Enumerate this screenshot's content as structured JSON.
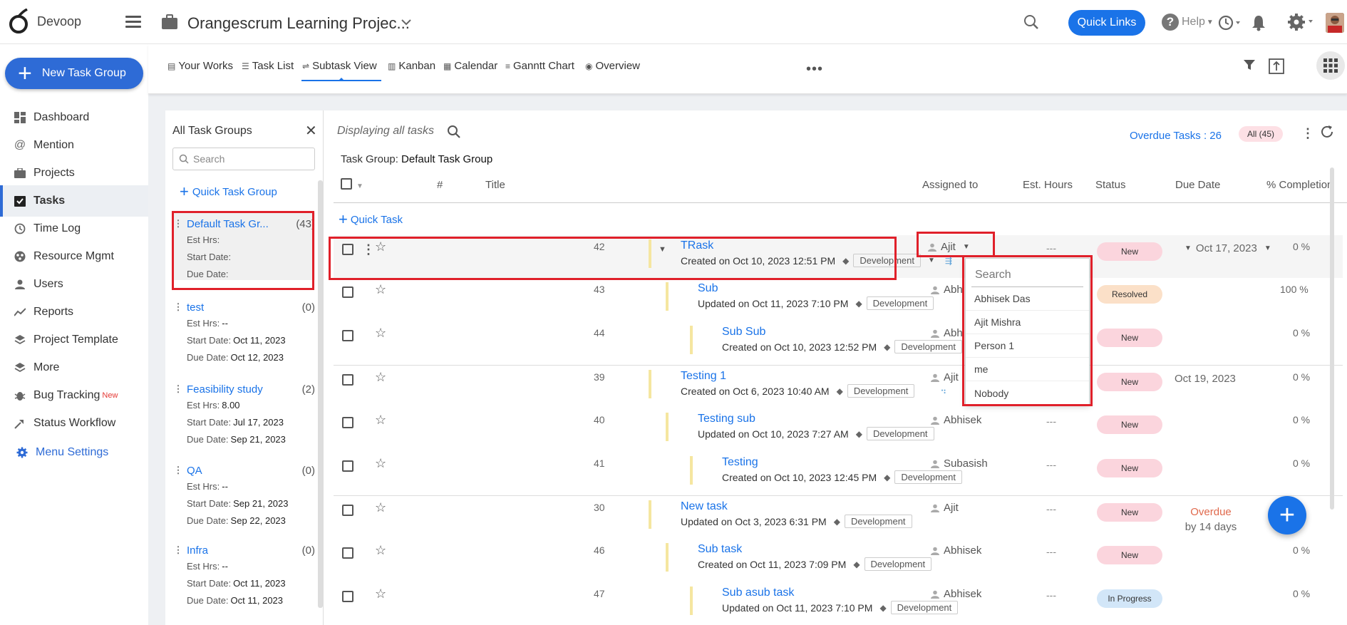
{
  "app": {
    "brand": "Devoop",
    "project_title": "Orangescrum Learning Projec...",
    "quick_links": "Quick Links",
    "help": "Help"
  },
  "sidebar": {
    "new_button": "New Task Group",
    "items": [
      {
        "label": "Dashboard",
        "icon": "dashboard-icon"
      },
      {
        "label": "Mention",
        "icon": "at-icon"
      },
      {
        "label": "Projects",
        "icon": "briefcase-icon"
      },
      {
        "label": "Tasks",
        "icon": "tasks-icon"
      },
      {
        "label": "Time Log",
        "icon": "clock-icon"
      },
      {
        "label": "Resource Mgmt",
        "icon": "resource-icon"
      },
      {
        "label": "Users",
        "icon": "user-icon"
      },
      {
        "label": "Reports",
        "icon": "chart-icon"
      },
      {
        "label": "Project Template",
        "icon": "layers-icon"
      },
      {
        "label": "More",
        "icon": "layers-icon"
      },
      {
        "label": "Bug Tracking",
        "icon": "bug-icon",
        "badge": "New"
      },
      {
        "label": "Status Workflow",
        "icon": "workflow-icon"
      }
    ],
    "menu_settings": "Menu Settings"
  },
  "views": {
    "tabs": [
      "Your Works",
      "Task List",
      "Subtask View",
      "Kanban",
      "Calendar",
      "Ganntt Chart",
      "Overview"
    ],
    "active": "Subtask View"
  },
  "groups_panel": {
    "title": "All Task Groups",
    "search_placeholder": "Search",
    "quick_group": "Quick Task Group",
    "groups": [
      {
        "name": "Default Task Gr...",
        "count": "(43)",
        "est_label": "Est Hrs:",
        "est": "",
        "start_label": "Start Date:",
        "start": "",
        "due_label": "Due Date:",
        "due": ""
      },
      {
        "name": "test",
        "count": "(0)",
        "est_label": "Est Hrs:",
        "est": "--",
        "start_label": "Start Date:",
        "start": "Oct 11, 2023",
        "due_label": "Due Date:",
        "due": "Oct 12, 2023"
      },
      {
        "name": "Feasibility study",
        "count": "(2)",
        "est_label": "Est Hrs:",
        "est": "8.00",
        "start_label": "Start Date:",
        "start": "Jul 17, 2023",
        "due_label": "Due Date:",
        "due": "Sep 21, 2023"
      },
      {
        "name": "QA",
        "count": "(0)",
        "est_label": "Est Hrs:",
        "est": "--",
        "start_label": "Start Date:",
        "start": "Sep 21, 2023",
        "due_label": "Due Date:",
        "due": "Sep 22, 2023"
      },
      {
        "name": "Infra",
        "count": "(0)",
        "est_label": "Est Hrs:",
        "est": "--",
        "start_label": "Start Date:",
        "start": "Oct 11, 2023",
        "due_label": "Due Date:",
        "due": "Oct 11, 2023"
      }
    ]
  },
  "tasks_area": {
    "display_text": "Displaying all tasks",
    "overdue": "Overdue Tasks : 26",
    "all_badge": "All (45)",
    "group_label": "Task Group:",
    "group_name": "Default Task Group",
    "quick_task": "Quick Task",
    "columns": [
      "#",
      "Title",
      "Assigned to",
      "Est. Hours",
      "Status",
      "Due Date",
      "% Completion"
    ]
  },
  "tasks": [
    {
      "num": "42",
      "title": "TRask",
      "meta": "Created on Oct 10, 2023 12:51 PM",
      "tag": "Development",
      "assigned": "Ajit",
      "est": "---",
      "status": "New",
      "due": "Oct 17, 2023",
      "pct": "0 %"
    },
    {
      "num": "43",
      "title": "Sub",
      "meta": "Updated on Oct 11, 2023 7:10 PM",
      "tag": "Development",
      "assigned": "Abh",
      "est": "",
      "status": "Resolved",
      "due": "",
      "pct": "100 %"
    },
    {
      "num": "44",
      "title": "Sub Sub",
      "meta": "Created on Oct 10, 2023 12:52 PM",
      "tag": "Development",
      "assigned": "Abh",
      "est": "",
      "status": "New",
      "due": "",
      "pct": "0 %"
    },
    {
      "num": "39",
      "title": "Testing 1",
      "meta": "Created on Oct 6, 2023 10:40 AM",
      "tag": "Development",
      "assigned": "Ajit",
      "est": "",
      "status": "New",
      "due": "Oct 19, 2023",
      "pct": "0 %"
    },
    {
      "num": "40",
      "title": "Testing sub",
      "meta": "Updated on Oct 10, 2023 7:27 AM",
      "tag": "Development",
      "assigned": "Abhisek",
      "est": "---",
      "status": "New",
      "due": "",
      "pct": "0 %"
    },
    {
      "num": "41",
      "title": "Testing",
      "meta": "Created on Oct 10, 2023 12:45 PM",
      "tag": "Development",
      "assigned": "Subasish",
      "est": "---",
      "status": "New",
      "due": "",
      "pct": "0 %"
    },
    {
      "num": "30",
      "title": "New task",
      "meta": "Updated on Oct 3, 2023 6:31 PM",
      "tag": "Development",
      "assigned": "Ajit",
      "est": "---",
      "status": "New",
      "due": "Overdue",
      "due2": "by 14 days",
      "pct": ""
    },
    {
      "num": "46",
      "title": "Sub task",
      "meta": "Created on Oct 11, 2023 7:09 PM",
      "tag": "Development",
      "assigned": "Abhisek",
      "est": "---",
      "status": "New",
      "due": "",
      "pct": "0 %"
    },
    {
      "num": "47",
      "title": "Sub asub task",
      "meta": "Updated on Oct 11, 2023 7:10 PM",
      "tag": "Development",
      "assigned": "Abhisek",
      "est": "---",
      "status": "In Progress",
      "due": "",
      "pct": "0 %"
    }
  ],
  "assign_dropdown": {
    "search_placeholder": "Search",
    "options": [
      "Abhisek Das",
      "Ajit Mishra",
      "Person 1",
      "me",
      "Nobody"
    ]
  },
  "colors": {
    "accent": "#1a73e8",
    "highlight": "#e0202a",
    "status_new": "#fbd5dd",
    "status_resolved": "#fbe0c8",
    "status_progress": "#d2e6f8"
  }
}
